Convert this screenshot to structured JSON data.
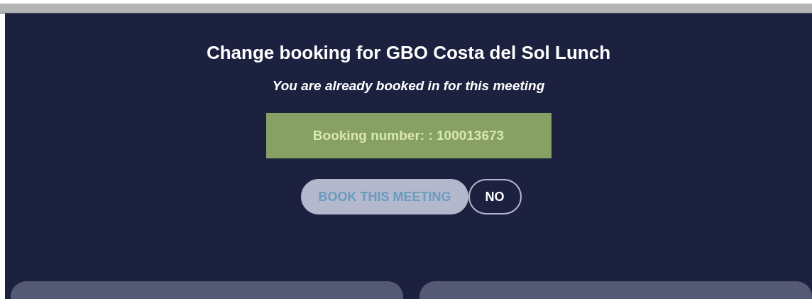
{
  "dialog": {
    "title": "Change booking for GBO Costa del Sol Lunch",
    "subtitle": "You are already booked in for this meeting",
    "booking_number": "Booking number: : 100013673",
    "buttons": [
      {
        "label": "BOOK THIS MEETING",
        "disabled": true
      },
      {
        "label": "NO",
        "disabled": false
      }
    ]
  }
}
